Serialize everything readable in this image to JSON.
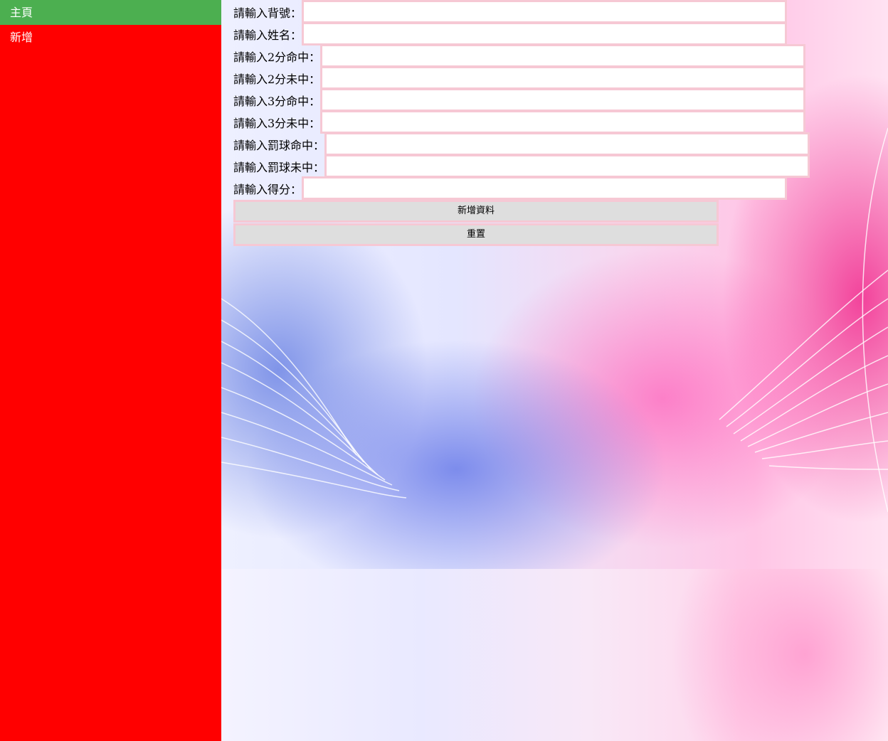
{
  "sidebar": {
    "items": [
      {
        "label": "主頁"
      },
      {
        "label": "新增"
      }
    ]
  },
  "form": {
    "fields": [
      {
        "label": "請輸入背號：",
        "value": ""
      },
      {
        "label": "請輸入姓名：",
        "value": ""
      },
      {
        "label": "請輸入2分命中：",
        "value": ""
      },
      {
        "label": "請輸入2分未中：",
        "value": ""
      },
      {
        "label": "請輸入3分命中：",
        "value": ""
      },
      {
        "label": "請輸入3分未中：",
        "value": ""
      },
      {
        "label": "請輸入罰球命中：",
        "value": ""
      },
      {
        "label": "請輸入罰球未中：",
        "value": ""
      },
      {
        "label": "請輸入得分：",
        "value": ""
      }
    ],
    "submit_label": "新增資料",
    "reset_label": "重置"
  },
  "colors": {
    "sidebar_bg": "#ff0000",
    "active_nav_bg": "#4caf50",
    "input_border": "#f6c8d4",
    "button_bg": "#dedede"
  }
}
